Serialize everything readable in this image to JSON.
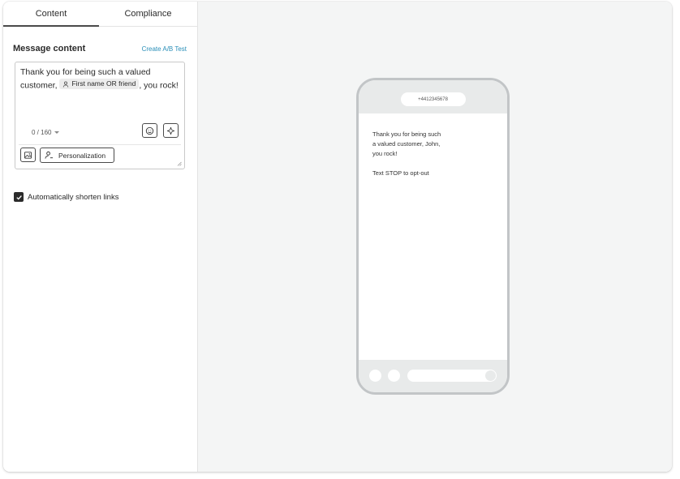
{
  "tabs": [
    {
      "label": "Content",
      "active": true
    },
    {
      "label": "Compliance",
      "active": false
    }
  ],
  "editor": {
    "title": "Message content",
    "ab_test_link": "Create A/B Test",
    "message_before": "Thank you for being such a valued customer,",
    "personalization_chip": "First name OR friend",
    "message_after": ", you rock!",
    "char_counter": "0 / 160",
    "personalization_button": "Personalization"
  },
  "options": {
    "shorten_links_label": "Automatically shorten links",
    "shorten_links_checked": true
  },
  "preview": {
    "phone_number": "+4412345678",
    "message": "Thank you for being such\na valued customer, John,\nyou rock!",
    "opt_out": "Text STOP to opt-out"
  },
  "colors": {
    "link": "#2a8fb8",
    "preview_bg": "#f4f5f5",
    "phone_border": "#c2c5c7"
  }
}
